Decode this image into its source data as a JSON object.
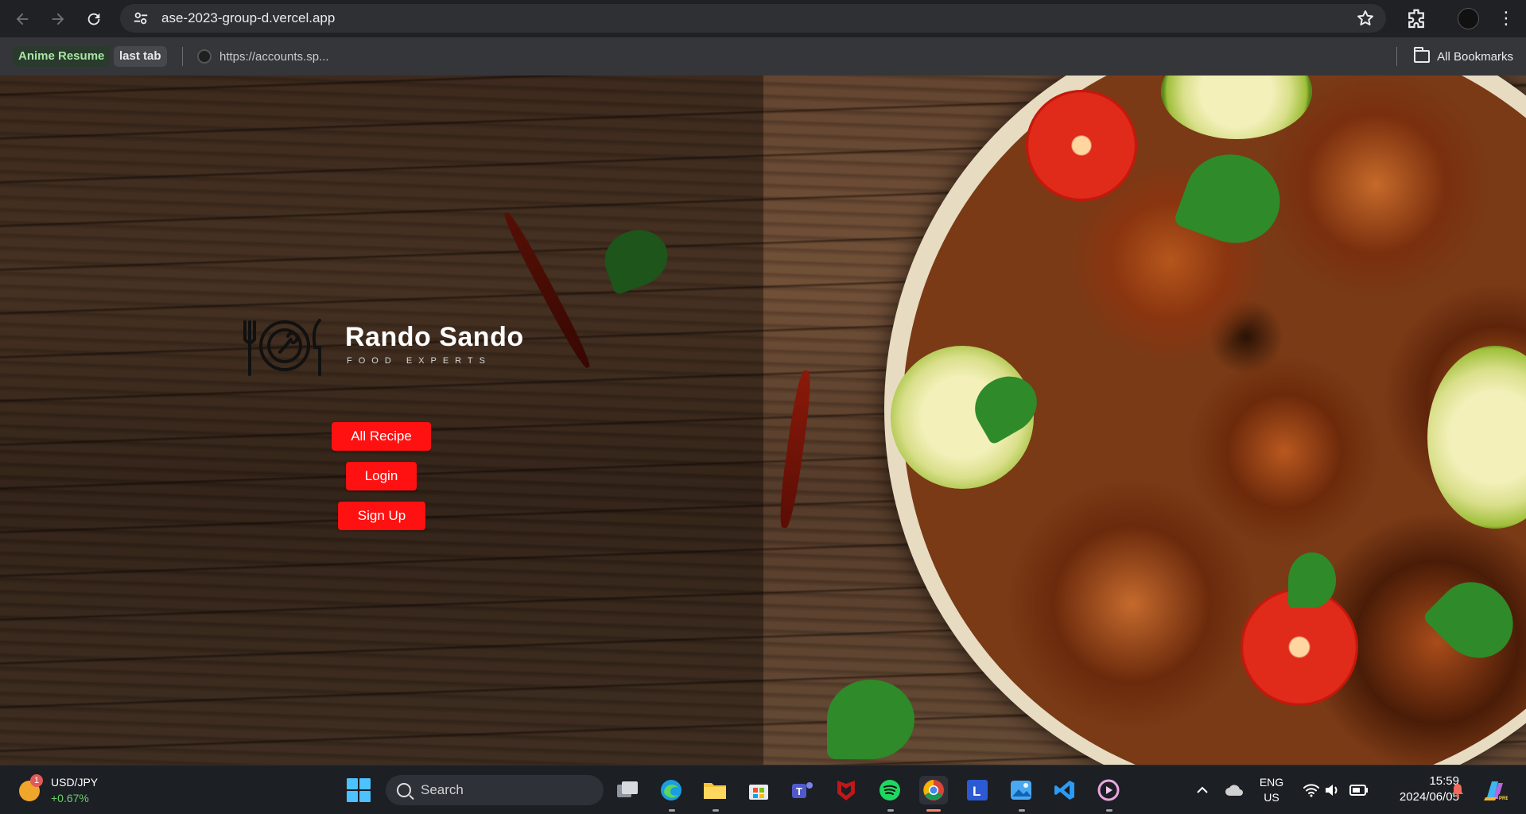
{
  "browser": {
    "url": "ase-2023-group-d.vercel.app",
    "bookmarks": {
      "items": [
        {
          "label": "Anime Resume"
        },
        {
          "label": "last tab"
        },
        {
          "label": "https://accounts.sp..."
        }
      ],
      "all_bookmarks": "All Bookmarks"
    }
  },
  "site": {
    "brand_title": "Rando Sando",
    "brand_subtitle": "FOOD EXPERTS",
    "buttons": {
      "all_recipe": "All Recipe",
      "login": "Login",
      "sign_up": "Sign Up"
    },
    "button_color": "#ff1111"
  },
  "taskbar": {
    "widget": {
      "badge_count": "1",
      "pair": "USD/JPY",
      "change": "+0.67%"
    },
    "search_placeholder": "Search",
    "language": {
      "line1": "ENG",
      "line2": "US"
    },
    "time": "15:59",
    "date": "2024/06/05",
    "apps": [
      "task-view",
      "edge",
      "file-explorer",
      "microsoft-store",
      "teams",
      "mcafee",
      "spotify",
      "chrome",
      "l-app",
      "photos",
      "vscode",
      "media-player"
    ]
  }
}
